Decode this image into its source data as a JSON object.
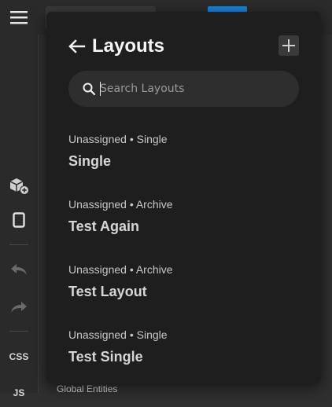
{
  "sidebar": {
    "items": [
      {
        "name": "menu-icon"
      },
      {
        "name": "add-block-icon"
      },
      {
        "name": "device-preview-icon"
      },
      {
        "name": "undo-icon"
      },
      {
        "name": "redo-icon"
      }
    ],
    "css_label": "CSS",
    "js_label": "JS"
  },
  "background": {
    "partial_text": "Global Entities"
  },
  "panel": {
    "title": "Layouts",
    "search": {
      "placeholder": "Search Layouts",
      "value": ""
    },
    "layouts": [
      {
        "meta": "Unassigned • Single",
        "name": "Single"
      },
      {
        "meta": "Unassigned • Archive",
        "name": "Test Again"
      },
      {
        "meta": "Unassigned • Archive",
        "name": "Test Layout"
      },
      {
        "meta": "Unassigned • Single",
        "name": "Test Single"
      }
    ]
  },
  "colors": {
    "panel_bg": "#1e1e1e",
    "sidebar_bg": "#2a2a2a",
    "accent_blue": "#1e84d8"
  }
}
